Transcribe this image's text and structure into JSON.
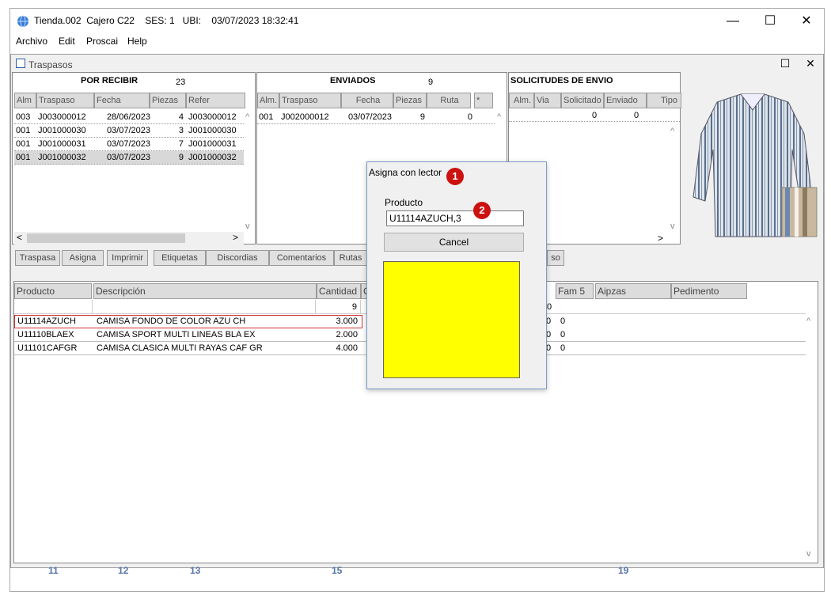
{
  "app": {
    "title": "Tienda.002  Cajero C22    SES: 1   UBI:    03/07/2023 18:32:41",
    "menu": [
      "Archivo",
      "Edit",
      "Proscai",
      "Help"
    ],
    "controls": {
      "minimize": "—",
      "maximize": "☐",
      "close": "✕"
    }
  },
  "child": {
    "title": "Traspasos",
    "controls": {
      "maximize": "☐",
      "close": "✕"
    }
  },
  "por_recibir": {
    "title": "POR RECIBIR",
    "count": "23",
    "columns": [
      "Alm",
      "Traspaso",
      "Fecha",
      "Piezas",
      "Refer"
    ],
    "rows": [
      [
        "003",
        "J003000012",
        "28/06/2023",
        "4",
        "J003000012"
      ],
      [
        "001",
        "J001000030",
        "03/07/2023",
        "3",
        "J001000030"
      ],
      [
        "001",
        "J001000031",
        "03/07/2023",
        "7",
        "J001000031"
      ],
      [
        "001",
        "J001000032",
        "03/07/2023",
        "9",
        "J001000032"
      ]
    ]
  },
  "enviados": {
    "title": "ENVIADOS",
    "count": "9",
    "columns": [
      "Alm.",
      "Traspaso",
      "Fecha",
      "Piezas",
      "Ruta",
      "*"
    ],
    "rows": [
      [
        "001",
        "J002000012",
        "03/07/2023",
        "9",
        "0",
        ""
      ]
    ]
  },
  "solicitudes": {
    "title": "SOLICITUDES DE ENVIO",
    "columns": [
      "Alm.",
      "Via",
      "Solicitado",
      "Enviado",
      "Tipo"
    ],
    "row": [
      "0",
      "0"
    ]
  },
  "tabs": [
    "Traspasa",
    "Asigna",
    "Imprimir",
    "Etiquetas",
    "Discordias",
    "Comentarios",
    "Rutas",
    "so"
  ],
  "detail": {
    "columns": [
      "Producto",
      "Descripción",
      "Cantidad",
      "C",
      "Fam 5",
      "Aipzas",
      "Pedimento"
    ],
    "total": "9",
    "total_zero": "0",
    "rows": [
      {
        "producto": "U11114AZUCH",
        "descripcion": "CAMISA FONDO DE COLOR AZU CH",
        "cantidad": "3.000",
        "c": "0",
        "fam5": "0"
      },
      {
        "producto": "U11110BLAEX",
        "descripcion": "CAMISA SPORT MULTI LINEAS BLA EX",
        "cantidad": "2.000",
        "c": "0",
        "fam5": "0"
      },
      {
        "producto": "U11101CAFGR",
        "descripcion": "CAMISA CLASICA MULTI RAYAS CAF GR",
        "cantidad": "4.000",
        "c": "0",
        "fam5": "0"
      }
    ]
  },
  "dialog": {
    "title": "Asigna con lector",
    "label": "Producto",
    "input_value": "U11114AZUCH,3",
    "cancel": "Cancel",
    "indicator_color": "#ffff00"
  },
  "badges": [
    "1",
    "2"
  ],
  "background_numbers": [
    "11",
    "12",
    "13",
    "15",
    "19"
  ]
}
